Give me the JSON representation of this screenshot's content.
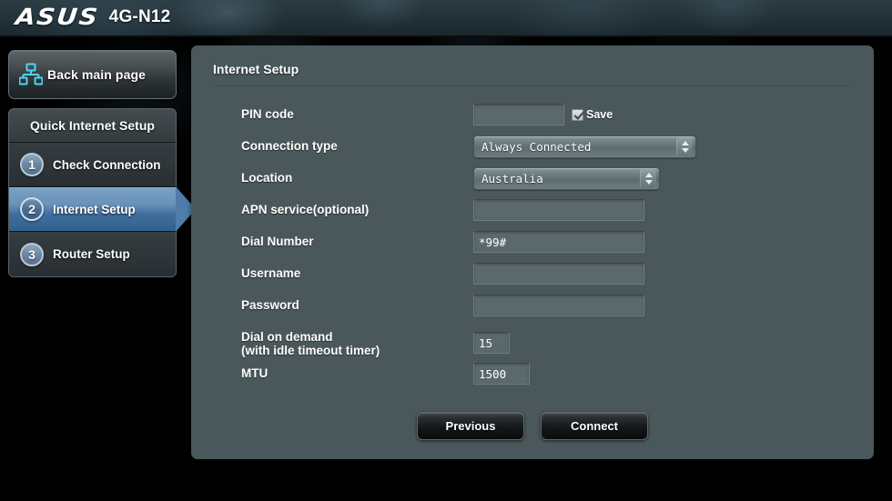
{
  "header": {
    "brand": "ASUS",
    "model": "4G-N12"
  },
  "sidebar": {
    "back_button": {
      "label": "Back main page",
      "icon": "network-sitemap-icon"
    },
    "group_title": "Quick Internet Setup",
    "items": [
      {
        "number": "1",
        "label": "Check Connection",
        "active": false
      },
      {
        "number": "2",
        "label": "Internet Setup",
        "active": true
      },
      {
        "number": "3",
        "label": "Router Setup",
        "active": false
      }
    ]
  },
  "main": {
    "title": "Internet Setup",
    "fields": {
      "pin_code": {
        "label": "PIN code",
        "value": "",
        "save_checkbox_label": "Save",
        "save_checked": true
      },
      "connection_type": {
        "label": "Connection type",
        "value": "Always Connected"
      },
      "location": {
        "label": "Location",
        "value": "Australia"
      },
      "apn_service": {
        "label": "APN service(optional)",
        "value": ""
      },
      "dial_number": {
        "label": "Dial Number",
        "value": "*99#"
      },
      "username": {
        "label": "Username",
        "value": ""
      },
      "password": {
        "label": "Password",
        "value": ""
      },
      "dial_on_demand": {
        "label_line1": "Dial on demand",
        "label_line2": "(with idle timeout timer)",
        "value": "15"
      },
      "mtu": {
        "label": "MTU",
        "value": "1500"
      }
    },
    "buttons": {
      "previous": "Previous",
      "connect": "Connect"
    }
  },
  "colors": {
    "panel_bg": "#4a585c",
    "accent_active": "#4f7ca8",
    "icon_cyan": "#4fd3f5",
    "field_bg": "#5b696d"
  }
}
